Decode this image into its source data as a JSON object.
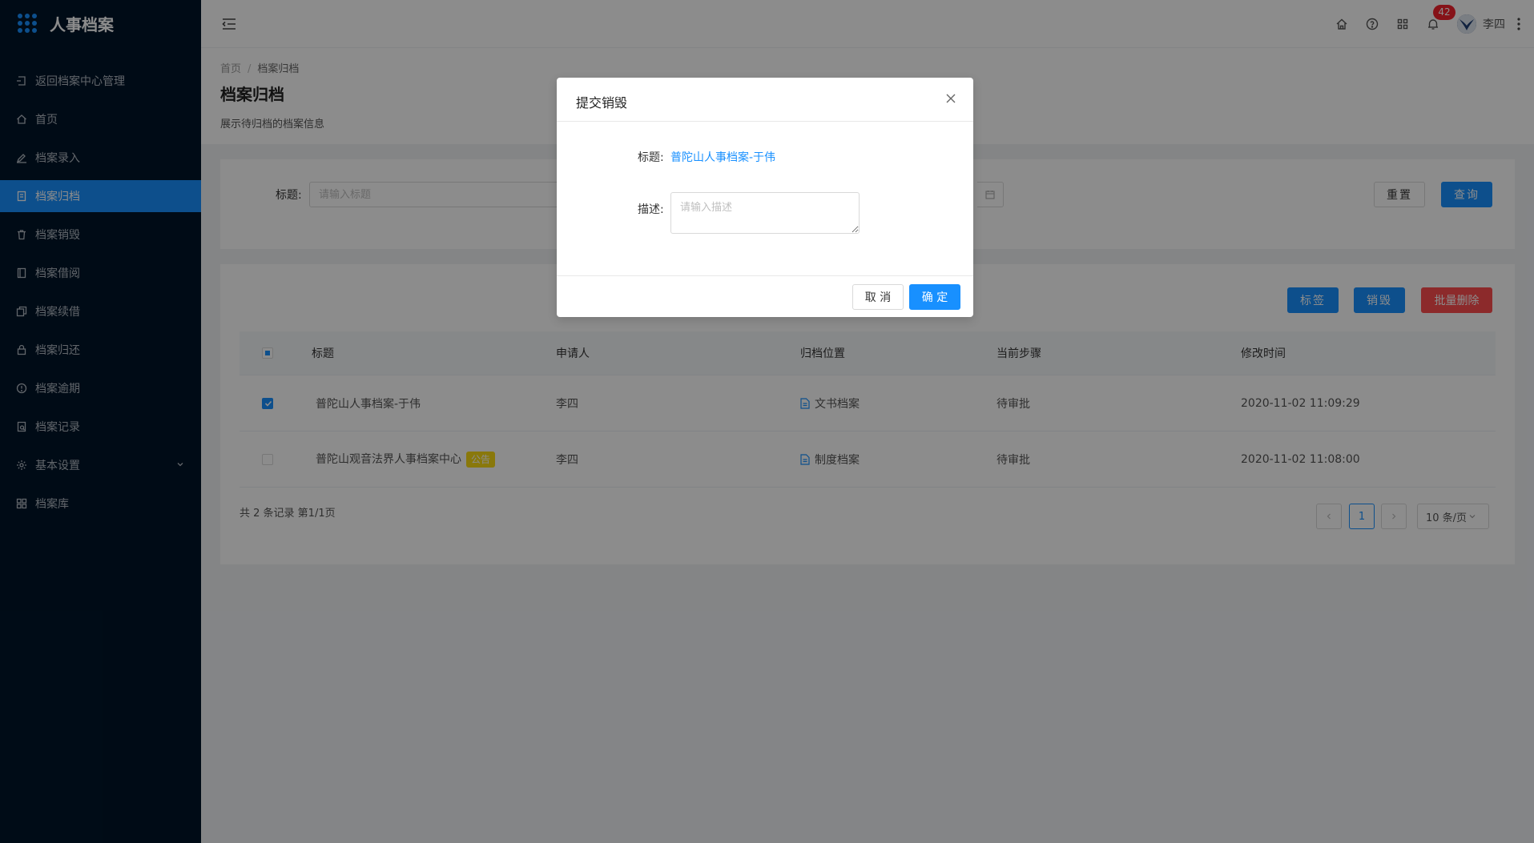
{
  "app": {
    "title": "人事档案"
  },
  "sidebar": {
    "items": [
      {
        "label": "返回档案中心管理",
        "icon": "back-icon"
      },
      {
        "label": "首页",
        "icon": "home-icon"
      },
      {
        "label": "档案录入",
        "icon": "edit-icon"
      },
      {
        "label": "档案归档",
        "icon": "archive-icon",
        "active": true
      },
      {
        "label": "档案销毁",
        "icon": "trash-icon"
      },
      {
        "label": "档案借阅",
        "icon": "book-icon"
      },
      {
        "label": "档案续借",
        "icon": "copy-icon"
      },
      {
        "label": "档案归还",
        "icon": "lock-icon"
      },
      {
        "label": "档案逾期",
        "icon": "clock-icon"
      },
      {
        "label": "档案记录",
        "icon": "record-icon"
      },
      {
        "label": "基本设置",
        "icon": "gear-icon",
        "has_submenu": true
      },
      {
        "label": "档案库",
        "icon": "grid-icon"
      }
    ]
  },
  "header": {
    "notification_count": "42",
    "username": "李四"
  },
  "page": {
    "breadcrumb": [
      "首页",
      "档案归档"
    ],
    "title": "档案归档",
    "description": "展示待归档的档案信息"
  },
  "search": {
    "title_label": "标题:",
    "title_placeholder": "请输入标题",
    "reset_label": "重置",
    "query_label": "查询"
  },
  "toolbar": {
    "tag_label": "标签",
    "destroy_label": "销毁",
    "batch_delete_label": "批量删除"
  },
  "table": {
    "columns": [
      "标题",
      "申请人",
      "归档位置",
      "当前步骤",
      "修改时间"
    ],
    "rows": [
      {
        "checked": true,
        "title": "普陀山人事档案-于伟",
        "tag": "",
        "applicant": "李四",
        "location": "文书档案",
        "step": "待审批",
        "modified": "2020-11-02 11:09:29"
      },
      {
        "checked": false,
        "title": "普陀山观音法界人事档案中心",
        "tag": "公告",
        "applicant": "李四",
        "location": "制度档案",
        "step": "待审批",
        "modified": "2020-11-02 11:08:00"
      }
    ]
  },
  "pagination": {
    "summary": "共 2 条记录 第1/1页",
    "current_page": "1",
    "page_size": "10 条/页"
  },
  "modal": {
    "title": "提交销毁",
    "title_label": "标题:",
    "title_value": "普陀山人事档案-于伟",
    "desc_label": "描述:",
    "desc_placeholder": "请输入描述",
    "cancel_label": "取 消",
    "confirm_label": "确 定"
  },
  "colors": {
    "primary": "#1890ff",
    "danger": "#ff4d4f",
    "sidebar_bg": "#001529",
    "tag_yellow": "#fadb14"
  }
}
